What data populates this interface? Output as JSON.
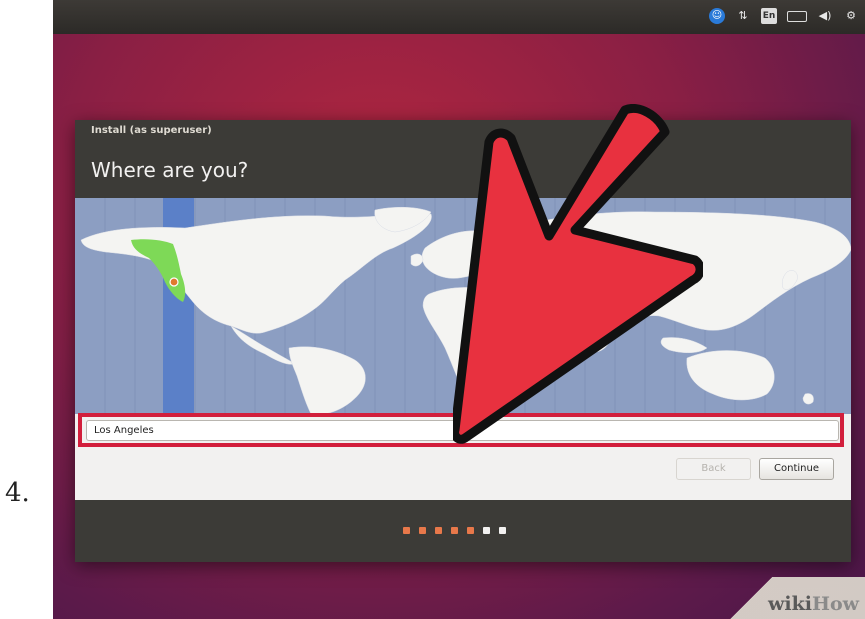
{
  "step_number": "4.",
  "window": {
    "title": "Install (as superuser)",
    "heading": "Where are you?"
  },
  "timezone": {
    "value": "Los Angeles"
  },
  "buttons": {
    "back": "Back",
    "continue": "Continue"
  },
  "progress": {
    "total_steps": 7,
    "current_step": 5,
    "done_color": "#e8784a",
    "todo_color": "#f2f1f0"
  },
  "watermark": {
    "brand_a": "wiki",
    "brand_b": "How"
  },
  "tray_icons": [
    "accessibility-icon",
    "network-icon",
    "keyboard-layout-icon",
    "battery-icon",
    "volume-icon",
    "settings-icon"
  ],
  "tray_lang": "En",
  "colors": {
    "highlight_red": "#d21f3c",
    "arrow_red": "#e8313f",
    "map_ocean": "#8c9ec2",
    "selected_zone": "#5b80c8",
    "selected_region": "#7ed957"
  }
}
